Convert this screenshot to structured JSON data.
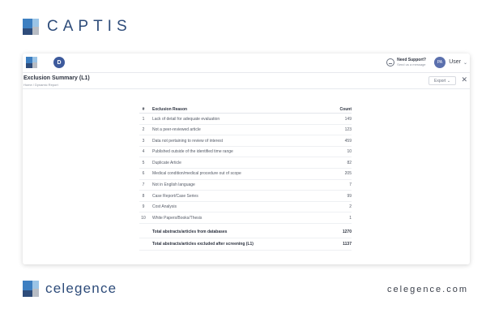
{
  "brand": {
    "name": "CAPTIS"
  },
  "topbar": {
    "avatar_letter": "D",
    "support_title": "Need Support?",
    "support_sub": "Send us a message",
    "user_initials": "PA",
    "user_label": "User",
    "user_chevron": "⌄"
  },
  "header": {
    "title": "Exclusion Summary (L1)",
    "breadcrumb": "Home / Dynamic Report",
    "export_label": "Export ⌄",
    "close_label": "✕"
  },
  "table": {
    "headers": {
      "num": "#",
      "reason": "Exclusion Reason",
      "count": "Count"
    },
    "rows": [
      {
        "num": "1",
        "reason": "Lack of detail for adequate evaluation",
        "count": "149"
      },
      {
        "num": "2",
        "reason": "Not a peer-reviewed article",
        "count": "123"
      },
      {
        "num": "3",
        "reason": "Data not pertaining to review of interest",
        "count": "459"
      },
      {
        "num": "4",
        "reason": "Published outside of the identified time range",
        "count": "10"
      },
      {
        "num": "5",
        "reason": "Duplicate Article",
        "count": "82"
      },
      {
        "num": "6",
        "reason": "Medical condition/medical procedure out of scope",
        "count": "205"
      },
      {
        "num": "7",
        "reason": "Not in English language",
        "count": "7"
      },
      {
        "num": "8",
        "reason": "Case Report/Case Series",
        "count": "99"
      },
      {
        "num": "9",
        "reason": "Cost Analysis",
        "count": "2"
      },
      {
        "num": "10",
        "reason": "White Papers/Books/Thesis",
        "count": "1"
      }
    ],
    "totals": [
      {
        "reason": "Total abstracts/articles from databases",
        "count": "1270"
      },
      {
        "reason": "Total abstracts/articles excluded after screening (L1)",
        "count": "1137"
      }
    ]
  },
  "footer": {
    "company": "celegence",
    "url": "celegence.com"
  },
  "colors": {
    "brand_navy": "#2e4c7a",
    "brand_blue": "#3d7fc1",
    "brand_light": "#9bc4e6",
    "brand_gray": "#b7bcc4"
  }
}
